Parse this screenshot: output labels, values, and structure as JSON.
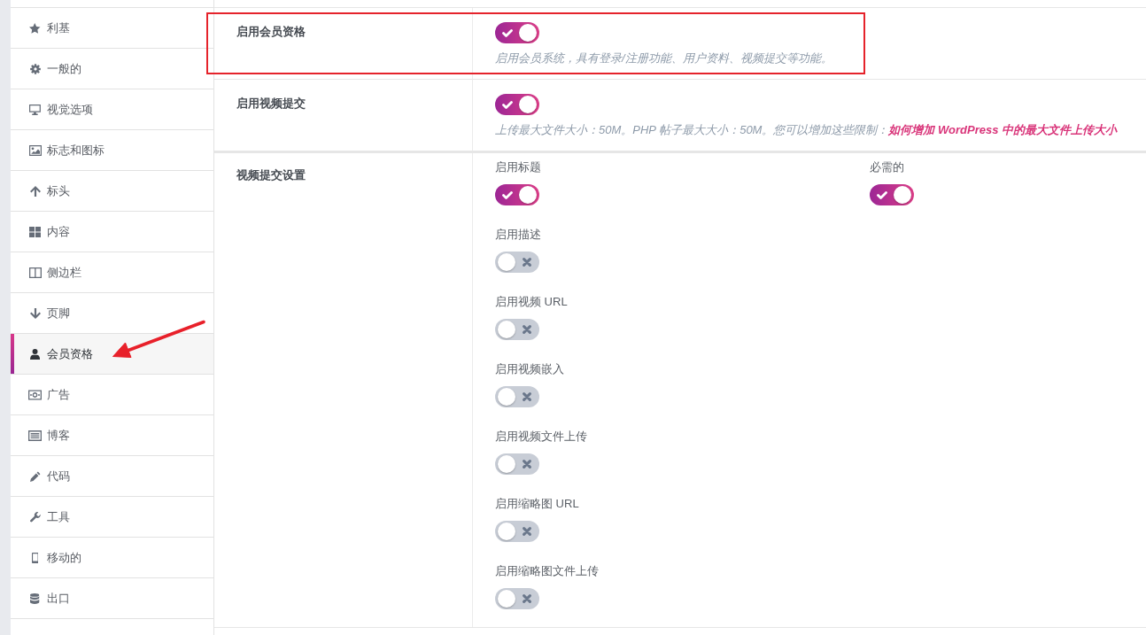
{
  "sidebar": {
    "items": [
      {
        "label": "利基",
        "selected": false,
        "pointed_at": false
      },
      {
        "label": "一般的",
        "selected": false,
        "pointed_at": false
      },
      {
        "label": "视觉选项",
        "selected": false,
        "pointed_at": false
      },
      {
        "label": "标志和图标",
        "selected": false,
        "pointed_at": false
      },
      {
        "label": "标头",
        "selected": false,
        "pointed_at": false
      },
      {
        "label": "内容",
        "selected": false,
        "pointed_at": false
      },
      {
        "label": "侧边栏",
        "selected": false,
        "pointed_at": false
      },
      {
        "label": "页脚",
        "selected": false,
        "pointed_at": false
      },
      {
        "label": "会员资格",
        "selected": true,
        "pointed_at": true
      },
      {
        "label": "广告",
        "selected": false,
        "pointed_at": false
      },
      {
        "label": "博客",
        "selected": false,
        "pointed_at": false
      },
      {
        "label": "代码",
        "selected": false,
        "pointed_at": false
      },
      {
        "label": "工具",
        "selected": false,
        "pointed_at": false
      },
      {
        "label": "移动的",
        "selected": false,
        "pointed_at": false
      },
      {
        "label": "出口",
        "selected": false,
        "pointed_at": false
      }
    ]
  },
  "settings": [
    {
      "kind": "switch",
      "label": "启用会员资格",
      "on": true,
      "description": "启用会员系统，具有登录/注册功能、用户资料、视频提交等功能。",
      "highlighted": true
    },
    {
      "kind": "switch",
      "label": "启用视频提交",
      "on": true,
      "description": "上传最大文件大小：50M。PHP 帖子最大大小：50M。您可以增加这些限制：",
      "link": "如何增加 WordPress 中的最大文件上传大小",
      "highlighted": false
    },
    {
      "kind": "group",
      "label": "视频提交设置",
      "highlighted": false,
      "options": [
        {
          "label": "启用标题",
          "on": true,
          "required": {
            "label": "必需的",
            "on": true
          }
        },
        {
          "label": "启用描述",
          "on": false
        },
        {
          "label": "启用视频 URL",
          "on": false
        },
        {
          "label": "启用视频嵌入",
          "on": false
        },
        {
          "label": "启用视频文件上传",
          "on": false
        },
        {
          "label": "启用缩略图 URL",
          "on": false
        },
        {
          "label": "启用缩略图文件上传",
          "on": false
        }
      ]
    }
  ]
}
